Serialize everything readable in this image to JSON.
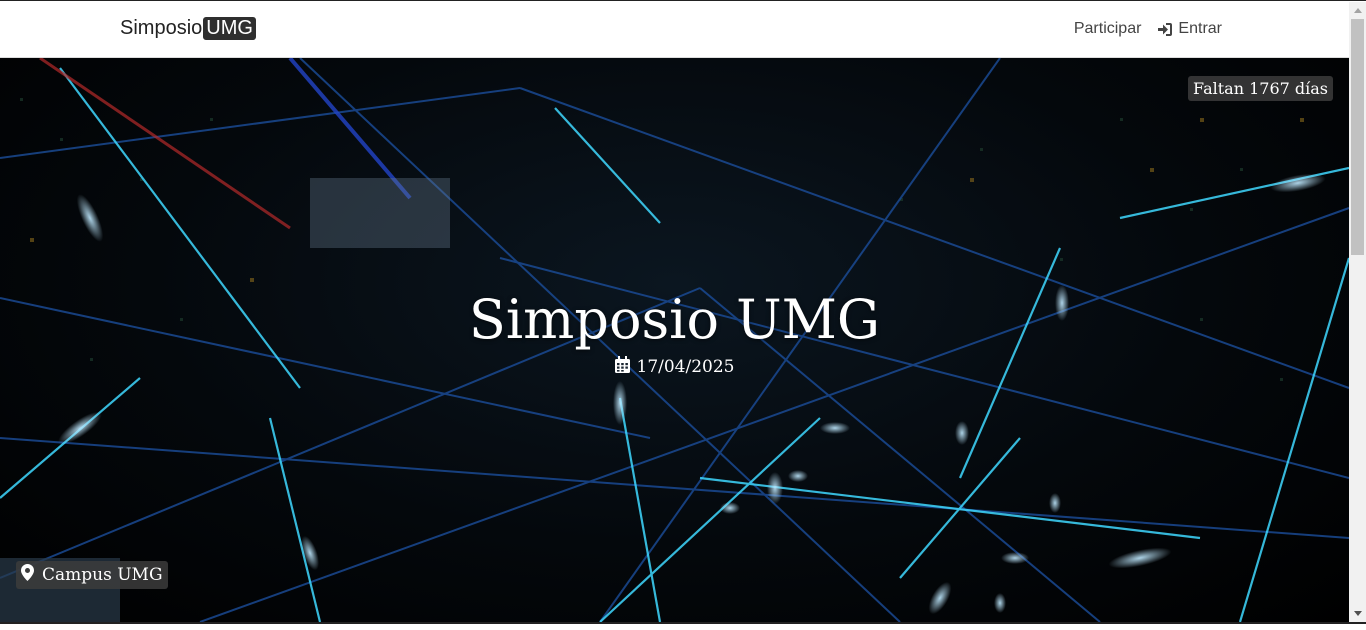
{
  "navbar": {
    "brand_text": "Simposio",
    "brand_badge": "UMG",
    "links": [
      {
        "label": "Participar",
        "icon": "none"
      },
      {
        "label": "Entrar",
        "icon": "sign-in-icon"
      }
    ]
  },
  "hero": {
    "countdown": "Faltan 1767 días",
    "title": "Simposio UMG",
    "date": "17/04/2025",
    "date_icon": "calendar-icon",
    "location": "Campus UMG",
    "location_icon": "map-marker-icon",
    "background_description_colors": {
      "accent_cyan": "#3fd8ff",
      "accent_blue": "#2a6fd1",
      "base": "#000000"
    }
  }
}
